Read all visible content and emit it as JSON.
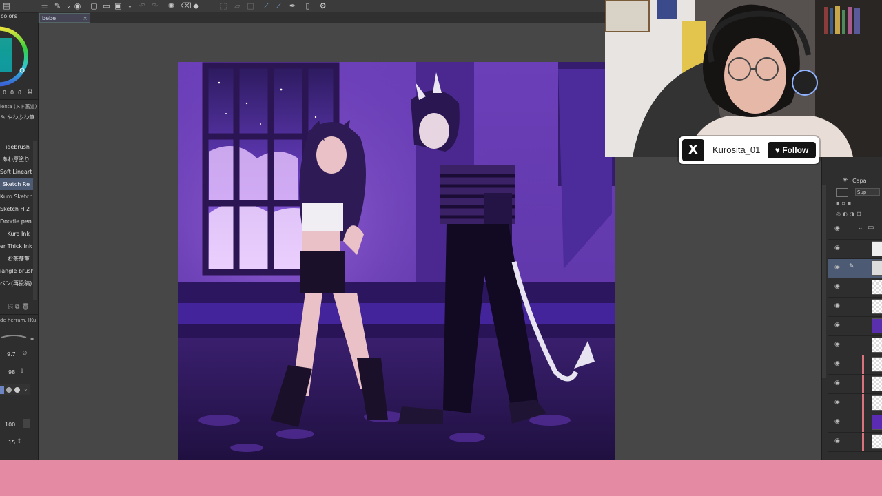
{
  "colors": {
    "bottom_bar": "#e48aa3",
    "canvas_bg": "#474747",
    "panel_bg": "#2e2e2e",
    "selection": "#4d5a74"
  },
  "document_tab": {
    "title": "bebe",
    "close_glyph": "×"
  },
  "left_panel": {
    "color_label": "colors",
    "color_values": [
      "0",
      "0",
      "0"
    ],
    "subtool_category": "ienta (メド蓄道)",
    "softbrush_group": "やわふわ筆",
    "brushes": [
      "idebrush",
      "あわ厚塗り",
      "Soft Lineart",
      "Sketch Re",
      "Kuro Sketch",
      "Sketch H 2",
      "Doodle pen",
      "Kuro Ink",
      "er Thick Ink",
      "お茶芽筆",
      "iangle brush",
      "ペン(再投稿)"
    ],
    "selected_brush_index": 3,
    "tool_property_label": "de herram. [Ku",
    "brush_size": "9.7",
    "opacity": "98",
    "density": "100",
    "stabilization": "15"
  },
  "layers_panel": {
    "tab_label": "Capa",
    "blend_mode": "Sup",
    "layer_count": 12
  },
  "stream_overlay": {
    "platform_icon": "x-logo-icon",
    "platform_glyph": "X",
    "handle": "Kurosita_01",
    "follow_label": "Follow",
    "heart_glyph": "♥"
  }
}
